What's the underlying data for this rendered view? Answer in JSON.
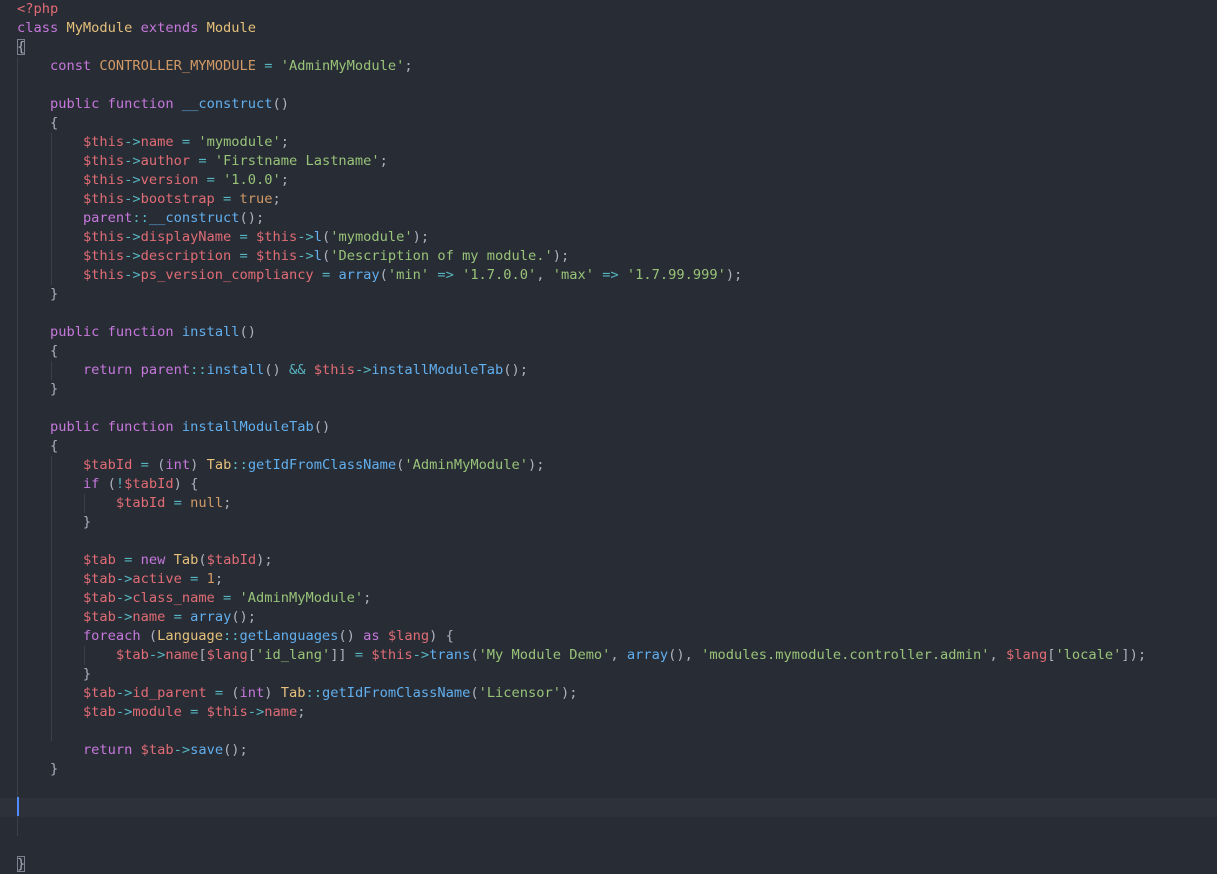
{
  "editor": {
    "language": "php",
    "theme_colors": {
      "background": "#282c34",
      "active_line": "#2c313a",
      "cursor": "#528bff",
      "keyword": "#c678dd",
      "class": "#e5c07b",
      "function": "#61afef",
      "string": "#98c379",
      "variable": "#e06c75",
      "constant": "#d19a66",
      "operator": "#56b6c2",
      "plain": "#abb2bf"
    },
    "cursor": {
      "line": 43,
      "column": 1
    },
    "lines": [
      [
        [
          "tag",
          "<?php"
        ]
      ],
      [
        [
          "keyword",
          "class"
        ],
        [
          "plain",
          " "
        ],
        [
          "class",
          "MyModule"
        ],
        [
          "plain",
          " "
        ],
        [
          "keyword",
          "extends"
        ],
        [
          "plain",
          " "
        ],
        [
          "class",
          "Module"
        ]
      ],
      [
        [
          "plain",
          "{"
        ]
      ],
      [
        [
          "plain",
          "    "
        ],
        [
          "keyword",
          "const"
        ],
        [
          "plain",
          " "
        ],
        [
          "constant",
          "CONTROLLER_MYMODULE"
        ],
        [
          "plain",
          " "
        ],
        [
          "operator",
          "="
        ],
        [
          "plain",
          " "
        ],
        [
          "string",
          "'AdminMyModule'"
        ],
        [
          "plain",
          ";"
        ]
      ],
      [],
      [
        [
          "plain",
          "    "
        ],
        [
          "keyword",
          "public"
        ],
        [
          "plain",
          " "
        ],
        [
          "keyword",
          "function"
        ],
        [
          "plain",
          " "
        ],
        [
          "function",
          "__construct"
        ],
        [
          "plain",
          "()"
        ]
      ],
      [
        [
          "plain",
          "    {"
        ]
      ],
      [
        [
          "plain",
          "        "
        ],
        [
          "variable",
          "$this"
        ],
        [
          "operator",
          "->"
        ],
        [
          "variable",
          "name"
        ],
        [
          "plain",
          " "
        ],
        [
          "operator",
          "="
        ],
        [
          "plain",
          " "
        ],
        [
          "string",
          "'mymodule'"
        ],
        [
          "plain",
          ";"
        ]
      ],
      [
        [
          "plain",
          "        "
        ],
        [
          "variable",
          "$this"
        ],
        [
          "operator",
          "->"
        ],
        [
          "variable",
          "author"
        ],
        [
          "plain",
          " "
        ],
        [
          "operator",
          "="
        ],
        [
          "plain",
          " "
        ],
        [
          "string",
          "'Firstname Lastname'"
        ],
        [
          "plain",
          ";"
        ]
      ],
      [
        [
          "plain",
          "        "
        ],
        [
          "variable",
          "$this"
        ],
        [
          "operator",
          "->"
        ],
        [
          "variable",
          "version"
        ],
        [
          "plain",
          " "
        ],
        [
          "operator",
          "="
        ],
        [
          "plain",
          " "
        ],
        [
          "string",
          "'1.0.0'"
        ],
        [
          "plain",
          ";"
        ]
      ],
      [
        [
          "plain",
          "        "
        ],
        [
          "variable",
          "$this"
        ],
        [
          "operator",
          "->"
        ],
        [
          "variable",
          "bootstrap"
        ],
        [
          "plain",
          " "
        ],
        [
          "operator",
          "="
        ],
        [
          "plain",
          " "
        ],
        [
          "constant",
          "true"
        ],
        [
          "plain",
          ";"
        ]
      ],
      [
        [
          "plain",
          "        "
        ],
        [
          "keyword",
          "parent"
        ],
        [
          "operator",
          "::"
        ],
        [
          "function",
          "__construct"
        ],
        [
          "plain",
          "();"
        ]
      ],
      [
        [
          "plain",
          "        "
        ],
        [
          "variable",
          "$this"
        ],
        [
          "operator",
          "->"
        ],
        [
          "variable",
          "displayName"
        ],
        [
          "plain",
          " "
        ],
        [
          "operator",
          "="
        ],
        [
          "plain",
          " "
        ],
        [
          "variable",
          "$this"
        ],
        [
          "operator",
          "->"
        ],
        [
          "function",
          "l"
        ],
        [
          "plain",
          "("
        ],
        [
          "string",
          "'mymodule'"
        ],
        [
          "plain",
          ");"
        ]
      ],
      [
        [
          "plain",
          "        "
        ],
        [
          "variable",
          "$this"
        ],
        [
          "operator",
          "->"
        ],
        [
          "variable",
          "description"
        ],
        [
          "plain",
          " "
        ],
        [
          "operator",
          "="
        ],
        [
          "plain",
          " "
        ],
        [
          "variable",
          "$this"
        ],
        [
          "operator",
          "->"
        ],
        [
          "function",
          "l"
        ],
        [
          "plain",
          "("
        ],
        [
          "string",
          "'Description of my module.'"
        ],
        [
          "plain",
          ");"
        ]
      ],
      [
        [
          "plain",
          "        "
        ],
        [
          "variable",
          "$this"
        ],
        [
          "operator",
          "->"
        ],
        [
          "variable",
          "ps_version_compliancy"
        ],
        [
          "plain",
          " "
        ],
        [
          "operator",
          "="
        ],
        [
          "plain",
          " "
        ],
        [
          "function",
          "array"
        ],
        [
          "plain",
          "("
        ],
        [
          "string",
          "'min'"
        ],
        [
          "plain",
          " "
        ],
        [
          "operator",
          "=>"
        ],
        [
          "plain",
          " "
        ],
        [
          "string",
          "'1.7.0.0'"
        ],
        [
          "plain",
          ", "
        ],
        [
          "string",
          "'max'"
        ],
        [
          "plain",
          " "
        ],
        [
          "operator",
          "=>"
        ],
        [
          "plain",
          " "
        ],
        [
          "string",
          "'1.7.99.999'"
        ],
        [
          "plain",
          ");"
        ]
      ],
      [
        [
          "plain",
          "    }"
        ]
      ],
      [],
      [
        [
          "plain",
          "    "
        ],
        [
          "keyword",
          "public"
        ],
        [
          "plain",
          " "
        ],
        [
          "keyword",
          "function"
        ],
        [
          "plain",
          " "
        ],
        [
          "function",
          "install"
        ],
        [
          "plain",
          "()"
        ]
      ],
      [
        [
          "plain",
          "    {"
        ]
      ],
      [
        [
          "plain",
          "        "
        ],
        [
          "keyword",
          "return"
        ],
        [
          "plain",
          " "
        ],
        [
          "keyword",
          "parent"
        ],
        [
          "operator",
          "::"
        ],
        [
          "function",
          "install"
        ],
        [
          "plain",
          "() "
        ],
        [
          "operator",
          "&&"
        ],
        [
          "plain",
          " "
        ],
        [
          "variable",
          "$this"
        ],
        [
          "operator",
          "->"
        ],
        [
          "function",
          "installModuleTab"
        ],
        [
          "plain",
          "();"
        ]
      ],
      [
        [
          "plain",
          "    }"
        ]
      ],
      [],
      [
        [
          "plain",
          "    "
        ],
        [
          "keyword",
          "public"
        ],
        [
          "plain",
          " "
        ],
        [
          "keyword",
          "function"
        ],
        [
          "plain",
          " "
        ],
        [
          "function",
          "installModuleTab"
        ],
        [
          "plain",
          "()"
        ]
      ],
      [
        [
          "plain",
          "    {"
        ]
      ],
      [
        [
          "plain",
          "        "
        ],
        [
          "variable",
          "$tabId"
        ],
        [
          "plain",
          " "
        ],
        [
          "operator",
          "="
        ],
        [
          "plain",
          " ("
        ],
        [
          "keyword",
          "int"
        ],
        [
          "plain",
          ") "
        ],
        [
          "class",
          "Tab"
        ],
        [
          "operator",
          "::"
        ],
        [
          "function",
          "getIdFromClassName"
        ],
        [
          "plain",
          "("
        ],
        [
          "string",
          "'AdminMyModule'"
        ],
        [
          "plain",
          ");"
        ]
      ],
      [
        [
          "plain",
          "        "
        ],
        [
          "keyword",
          "if"
        ],
        [
          "plain",
          " ("
        ],
        [
          "operator",
          "!"
        ],
        [
          "variable",
          "$tabId"
        ],
        [
          "plain",
          ") {"
        ]
      ],
      [
        [
          "plain",
          "            "
        ],
        [
          "variable",
          "$tabId"
        ],
        [
          "plain",
          " "
        ],
        [
          "operator",
          "="
        ],
        [
          "plain",
          " "
        ],
        [
          "constant",
          "null"
        ],
        [
          "plain",
          ";"
        ]
      ],
      [
        [
          "plain",
          "        }"
        ]
      ],
      [],
      [
        [
          "plain",
          "        "
        ],
        [
          "variable",
          "$tab"
        ],
        [
          "plain",
          " "
        ],
        [
          "operator",
          "="
        ],
        [
          "plain",
          " "
        ],
        [
          "keyword",
          "new"
        ],
        [
          "plain",
          " "
        ],
        [
          "class",
          "Tab"
        ],
        [
          "plain",
          "("
        ],
        [
          "variable",
          "$tabId"
        ],
        [
          "plain",
          ");"
        ]
      ],
      [
        [
          "plain",
          "        "
        ],
        [
          "variable",
          "$tab"
        ],
        [
          "operator",
          "->"
        ],
        [
          "variable",
          "active"
        ],
        [
          "plain",
          " "
        ],
        [
          "operator",
          "="
        ],
        [
          "plain",
          " "
        ],
        [
          "number",
          "1"
        ],
        [
          "plain",
          ";"
        ]
      ],
      [
        [
          "plain",
          "        "
        ],
        [
          "variable",
          "$tab"
        ],
        [
          "operator",
          "->"
        ],
        [
          "variable",
          "class_name"
        ],
        [
          "plain",
          " "
        ],
        [
          "operator",
          "="
        ],
        [
          "plain",
          " "
        ],
        [
          "string",
          "'AdminMyModule'"
        ],
        [
          "plain",
          ";"
        ]
      ],
      [
        [
          "plain",
          "        "
        ],
        [
          "variable",
          "$tab"
        ],
        [
          "operator",
          "->"
        ],
        [
          "variable",
          "name"
        ],
        [
          "plain",
          " "
        ],
        [
          "operator",
          "="
        ],
        [
          "plain",
          " "
        ],
        [
          "function",
          "array"
        ],
        [
          "plain",
          "();"
        ]
      ],
      [
        [
          "plain",
          "        "
        ],
        [
          "keyword",
          "foreach"
        ],
        [
          "plain",
          " ("
        ],
        [
          "class",
          "Language"
        ],
        [
          "operator",
          "::"
        ],
        [
          "function",
          "getLanguages"
        ],
        [
          "plain",
          "() "
        ],
        [
          "keyword",
          "as"
        ],
        [
          "plain",
          " "
        ],
        [
          "variable",
          "$lang"
        ],
        [
          "plain",
          ") {"
        ]
      ],
      [
        [
          "plain",
          "            "
        ],
        [
          "variable",
          "$tab"
        ],
        [
          "operator",
          "->"
        ],
        [
          "variable",
          "name"
        ],
        [
          "plain",
          "["
        ],
        [
          "variable",
          "$lang"
        ],
        [
          "plain",
          "["
        ],
        [
          "string",
          "'id_lang'"
        ],
        [
          "plain",
          "]] "
        ],
        [
          "operator",
          "="
        ],
        [
          "plain",
          " "
        ],
        [
          "variable",
          "$this"
        ],
        [
          "operator",
          "->"
        ],
        [
          "function",
          "trans"
        ],
        [
          "plain",
          "("
        ],
        [
          "string",
          "'My Module Demo'"
        ],
        [
          "plain",
          ", "
        ],
        [
          "function",
          "array"
        ],
        [
          "plain",
          "(), "
        ],
        [
          "string",
          "'modules.mymodule.controller.admin'"
        ],
        [
          "plain",
          ", "
        ],
        [
          "variable",
          "$lang"
        ],
        [
          "plain",
          "["
        ],
        [
          "string",
          "'locale'"
        ],
        [
          "plain",
          "]);"
        ]
      ],
      [
        [
          "plain",
          "        }"
        ]
      ],
      [
        [
          "plain",
          "        "
        ],
        [
          "variable",
          "$tab"
        ],
        [
          "operator",
          "->"
        ],
        [
          "variable",
          "id_parent"
        ],
        [
          "plain",
          " "
        ],
        [
          "operator",
          "="
        ],
        [
          "plain",
          " ("
        ],
        [
          "keyword",
          "int"
        ],
        [
          "plain",
          ") "
        ],
        [
          "class",
          "Tab"
        ],
        [
          "operator",
          "::"
        ],
        [
          "function",
          "getIdFromClassName"
        ],
        [
          "plain",
          "("
        ],
        [
          "string",
          "'Licensor'"
        ],
        [
          "plain",
          ");"
        ]
      ],
      [
        [
          "plain",
          "        "
        ],
        [
          "variable",
          "$tab"
        ],
        [
          "operator",
          "->"
        ],
        [
          "variable",
          "module"
        ],
        [
          "plain",
          " "
        ],
        [
          "operator",
          "="
        ],
        [
          "plain",
          " "
        ],
        [
          "variable",
          "$this"
        ],
        [
          "operator",
          "->"
        ],
        [
          "variable",
          "name"
        ],
        [
          "plain",
          ";"
        ]
      ],
      [],
      [
        [
          "plain",
          "        "
        ],
        [
          "keyword",
          "return"
        ],
        [
          "plain",
          " "
        ],
        [
          "variable",
          "$tab"
        ],
        [
          "operator",
          "->"
        ],
        [
          "function",
          "save"
        ],
        [
          "plain",
          "();"
        ]
      ],
      [
        [
          "plain",
          "    }"
        ]
      ],
      [],
      [],
      [],
      [],
      [
        [
          "plain",
          "}"
        ]
      ]
    ]
  }
}
